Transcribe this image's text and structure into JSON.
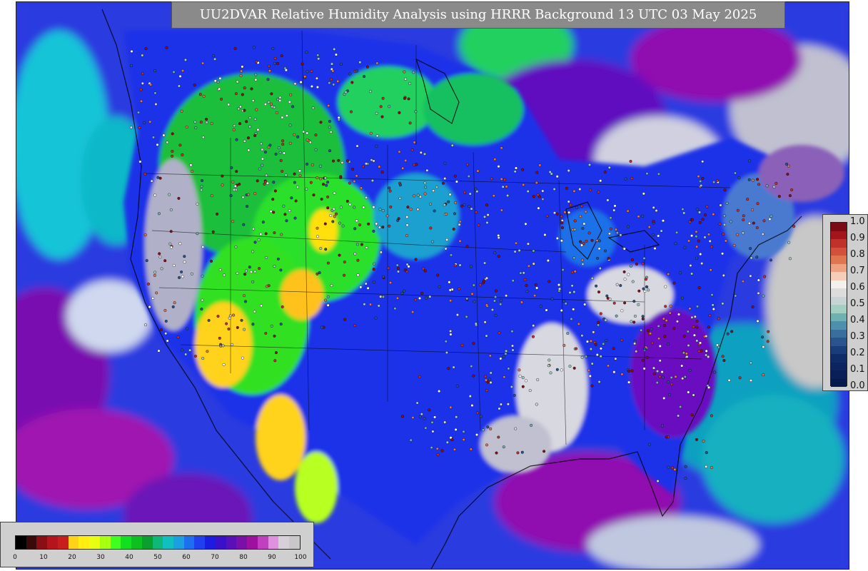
{
  "title": "UU2DVAR Relative Humidity Analysis using HRRR Background 13 UTC 03 May 2025",
  "station_colorbar": {
    "ticks": [
      "1.0",
      "0.9",
      "0.8",
      "0.7",
      "0.6",
      "0.5",
      "0.4",
      "0.3",
      "0.2",
      "0.1",
      "0.0"
    ],
    "colors": [
      "#7a0a14",
      "#a3141c",
      "#c0312a",
      "#d1513a",
      "#e07650",
      "#eea281",
      "#f6cdb8",
      "#f3f0ee",
      "#dcdcdc",
      "#c8d3d6",
      "#a2cfc2",
      "#6fb0b0",
      "#4e8fae",
      "#3a6e9c",
      "#2b538e",
      "#1a3c7a",
      "#102c68",
      "#0c2460",
      "#0a1f58",
      "#071a4e"
    ]
  },
  "analysis_colorbar": {
    "ticks": [
      "0",
      "10",
      "20",
      "30",
      "40",
      "50",
      "60",
      "70",
      "80",
      "90",
      "100"
    ],
    "colors": [
      "#000000",
      "#3a0a0a",
      "#8a0f14",
      "#b4141c",
      "#c81e20",
      "#ffd21a",
      "#ffee10",
      "#e8ff10",
      "#a8ff10",
      "#40ff20",
      "#10e020",
      "#0cc020",
      "#0aa030",
      "#10b878",
      "#10c0c0",
      "#1aa0e0",
      "#1c70f0",
      "#2040f0",
      "#1c1ce0",
      "#3a10c8",
      "#5a10b8",
      "#7a10a8",
      "#a010a0",
      "#c040c0",
      "#e090e0",
      "#d8d0d8",
      "#c8c8c8"
    ]
  },
  "colors": {
    "title_background": "#8a8a8a",
    "title_text": "#ffffff",
    "ocean_blue": "#2a3be0",
    "land_outline": "#000000",
    "dry_orange": "#ffc21a",
    "green": "#1fdc1f",
    "purple": "#8a10b0"
  }
}
